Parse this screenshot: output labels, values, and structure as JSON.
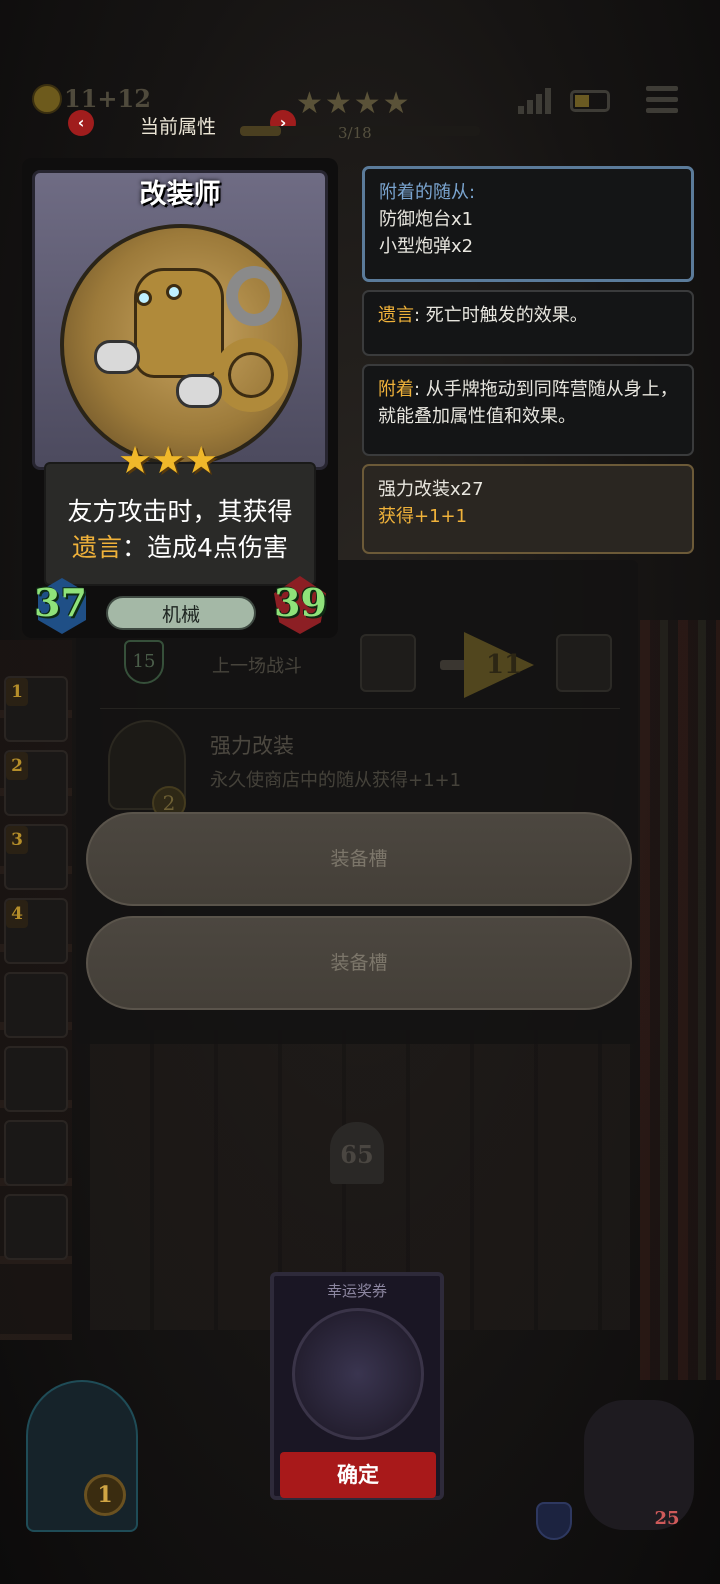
{
  "top_bar": {
    "gold_current": "11",
    "gold_bonus": "+12",
    "star_rating": "★★★★",
    "attr_title": "当前属性",
    "progress_text": "3/18",
    "progress_fraction": 0.17,
    "nav_prev": "‹",
    "nav_next": "›"
  },
  "card": {
    "name": "改装师",
    "stars": "★★★",
    "desc_line1": "友方攻击时，其获得",
    "desc_keyword": "遗言",
    "desc_line2_rest": "：造成4点伤害",
    "attack": "37",
    "health": "39",
    "tribe": "机械"
  },
  "info": {
    "attached_header": "附着的随从:",
    "attached_items": [
      "防御炮台x1",
      "小型炮弹x2"
    ],
    "deathrattle_kw": "遗言",
    "deathrattle_text": ": 死亡时触发的效果。",
    "attach_kw": "附着",
    "attach_text": ": 从手牌拖动到同阵营随从身上，就能叠加属性值和效果。",
    "buff_name": "强力改装x27",
    "buff_gain": "获得+1+1"
  },
  "background": {
    "shield_value": "15",
    "last_battle_label": "上一场战斗",
    "arrow_value": "11",
    "upgrade_title": "强力改装",
    "upgrade_desc": "永久使商店中的随从获得+1+1",
    "upgrade_badge": "2",
    "tomb_value": "65"
  },
  "equip_slots": [
    "装备槽",
    "装备槽"
  ],
  "sidebar_numbers": [
    "1",
    "2",
    "3",
    "4"
  ],
  "ticket": {
    "title": "幸运奖券",
    "confirm": "确定"
  },
  "bottom": {
    "door_badge": "1",
    "hero_hp": "25"
  },
  "colors": {
    "accent_gold": "#f0b23a",
    "attack_green": "#8fe27a",
    "confirm_red": "#a8191a",
    "attach_border_blue": "#5b7b9a"
  }
}
